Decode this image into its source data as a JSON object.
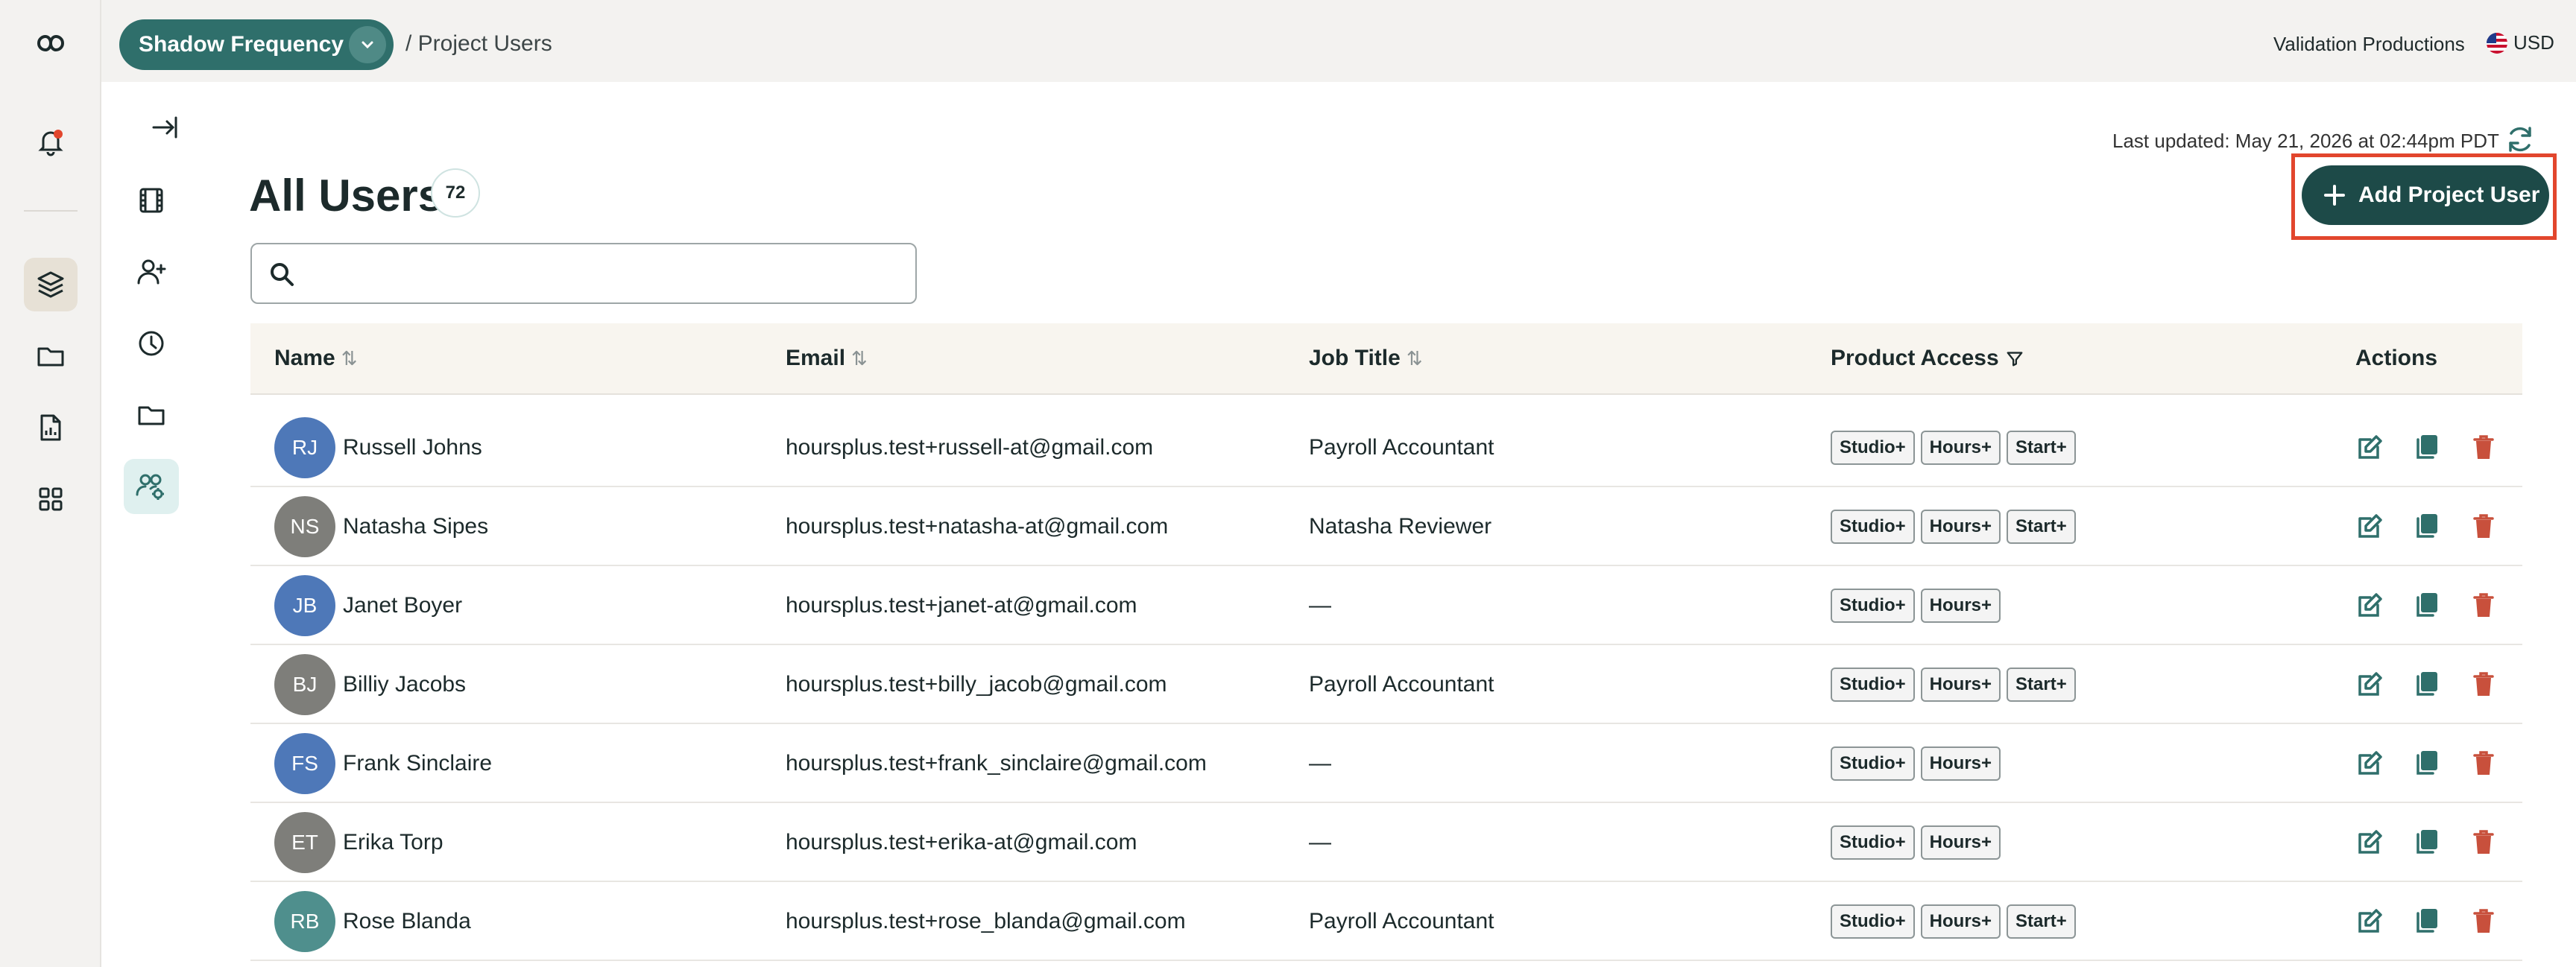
{
  "header": {
    "project_name": "Shadow Frequency",
    "breadcrumb": "/ Project Users",
    "company": "Validation Productions",
    "currency": "USD",
    "last_updated": "Last updated: May 21, 2026 at 02:44pm PDT"
  },
  "page": {
    "title": "All Users",
    "count": "72",
    "add_button_label": "Add Project User",
    "search_placeholder": ""
  },
  "table": {
    "columns": {
      "name": "Name",
      "email": "Email",
      "job_title": "Job Title",
      "product_access": "Product Access",
      "actions": "Actions"
    },
    "rows": [
      {
        "initials": "RJ",
        "name": "Russell Johns",
        "email": "hoursplus.test+russell-at@gmail.com",
        "job": "Payroll Accountant",
        "access": [
          "Studio+",
          "Hours+",
          "Start+"
        ],
        "avatar_color": "#4e78b8"
      },
      {
        "initials": "NS",
        "name": "Natasha Sipes",
        "email": "hoursplus.test+natasha-at@gmail.com",
        "job": "Natasha Reviewer",
        "access": [
          "Studio+",
          "Hours+",
          "Start+"
        ],
        "avatar_color": "#7e7e7a"
      },
      {
        "initials": "JB",
        "name": "Janet Boyer",
        "email": "hoursplus.test+janet-at@gmail.com",
        "job": "—",
        "access": [
          "Studio+",
          "Hours+"
        ],
        "avatar_color": "#4e78b8"
      },
      {
        "initials": "BJ",
        "name": "Billiy Jacobs",
        "email": "hoursplus.test+billy_jacob@gmail.com",
        "job": "Payroll Accountant",
        "access": [
          "Studio+",
          "Hours+",
          "Start+"
        ],
        "avatar_color": "#7e7e7a"
      },
      {
        "initials": "FS",
        "name": "Frank Sinclaire",
        "email": "hoursplus.test+frank_sinclaire@gmail.com",
        "job": "—",
        "access": [
          "Studio+",
          "Hours+"
        ],
        "avatar_color": "#4e78b8"
      },
      {
        "initials": "ET",
        "name": "Erika Torp",
        "email": "hoursplus.test+erika-at@gmail.com",
        "job": "—",
        "access": [
          "Studio+",
          "Hours+"
        ],
        "avatar_color": "#7e7e7a"
      },
      {
        "initials": "RB",
        "name": "Rose Blanda",
        "email": "hoursplus.test+rose_blanda@gmail.com",
        "job": "Payroll Accountant",
        "access": [
          "Studio+",
          "Hours+",
          "Start+"
        ],
        "avatar_color": "#4f8f8d"
      }
    ]
  },
  "colors": {
    "accent": "#2f6f6b",
    "dark_button": "#1d4a48",
    "delete": "#c8503c",
    "highlight": "#e2462d"
  }
}
